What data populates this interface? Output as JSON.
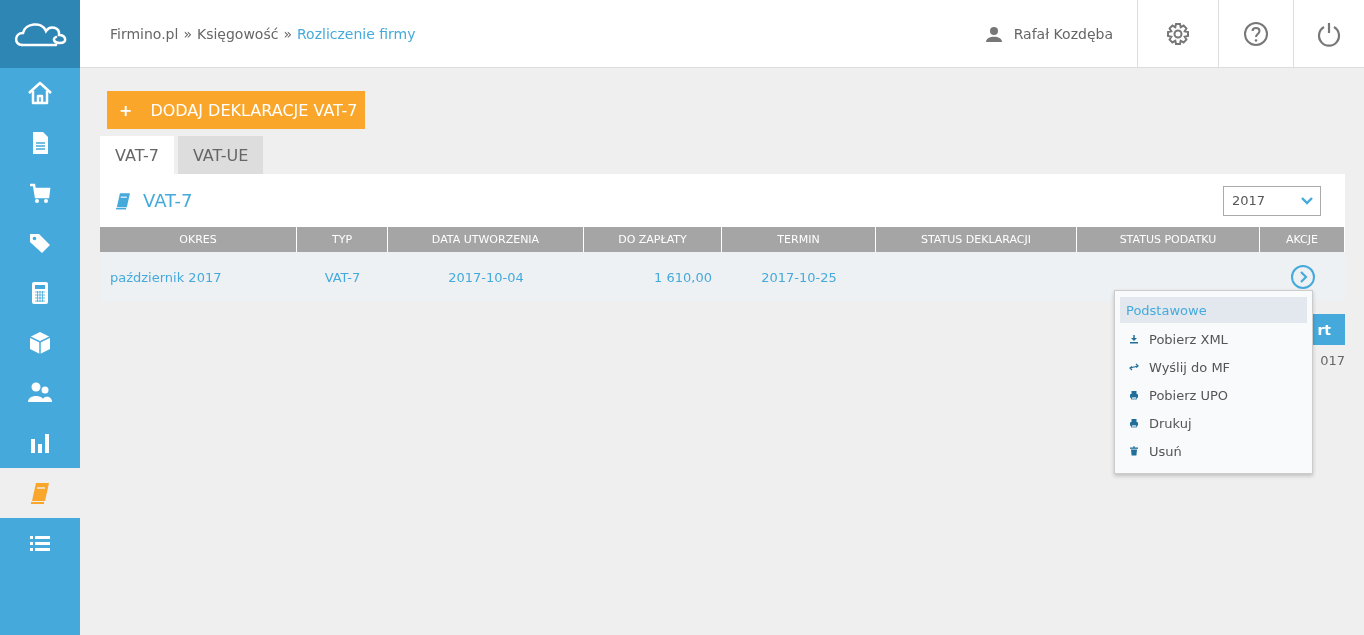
{
  "breadcrumb": [
    {
      "label": "Firmino.pl",
      "current": false
    },
    {
      "label": "Księgowość",
      "current": false
    },
    {
      "label": "Rozliczenie firmy",
      "current": true
    }
  ],
  "breadcrumb_separator": "»",
  "user": {
    "name": "Rafał Kozdęba"
  },
  "sidebar": {
    "items": [
      {
        "kind": "home",
        "selected": false
      },
      {
        "kind": "document",
        "selected": false
      },
      {
        "kind": "cart",
        "selected": false
      },
      {
        "kind": "tags",
        "selected": false
      },
      {
        "kind": "calculator",
        "selected": false
      },
      {
        "kind": "box",
        "selected": false
      },
      {
        "kind": "users",
        "selected": false
      },
      {
        "kind": "chart",
        "selected": false
      },
      {
        "kind": "book",
        "selected": true
      },
      {
        "kind": "list",
        "selected": false
      }
    ]
  },
  "add_button": {
    "icon": "+",
    "label": "DODAJ DEKLARACJE VAT-7"
  },
  "tabs": [
    {
      "label": "VAT-7",
      "selected": true
    },
    {
      "label": "VAT-UE",
      "selected": false
    }
  ],
  "panel": {
    "title": "VAT-7",
    "year": "2017"
  },
  "table": {
    "columns": [
      "OKRES",
      "TYP",
      "DATA UTWORZENIA",
      "DO ZAPŁATY",
      "TERMIN",
      "STATUS DEKLARACJI",
      "STATUS PODATKU",
      "AKCJE"
    ],
    "rows": [
      {
        "cells": [
          "październik 2017",
          "VAT-7",
          "2017-10-04",
          "1 610,00",
          "2017-10-25",
          "",
          ""
        ]
      }
    ]
  },
  "behind_menu": {
    "button": "rt",
    "text": "017"
  },
  "menu": {
    "header": "Podstawowe",
    "items": [
      {
        "kind": "download",
        "label": "Pobierz XML"
      },
      {
        "kind": "exchange",
        "label": "Wyślij do MF"
      },
      {
        "kind": "print",
        "label": "Pobierz UPO"
      },
      {
        "kind": "print",
        "label": "Drukuj"
      },
      {
        "kind": "trash",
        "label": "Usuń"
      }
    ]
  }
}
